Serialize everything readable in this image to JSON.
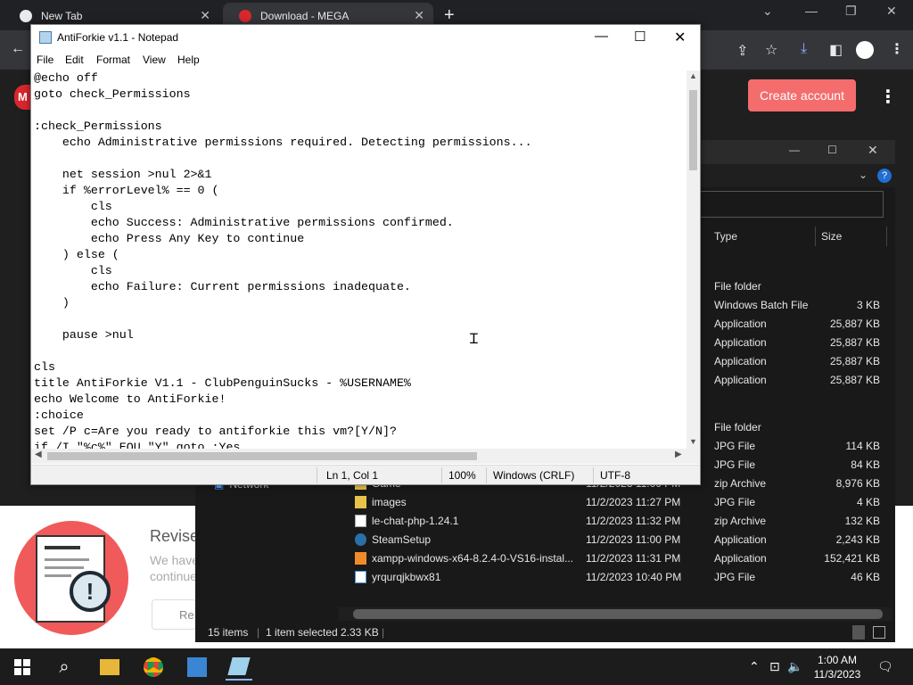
{
  "chrome": {
    "tabs": [
      {
        "title": "New Tab"
      },
      {
        "title": "Download - MEGA"
      }
    ],
    "new_tab": "+",
    "controls": {
      "minimize": "—",
      "restore": "❐",
      "close": "✕"
    }
  },
  "mega": {
    "create_account": "Create account",
    "logo": "M",
    "revise_title": "Revise",
    "revise_text": "We have continue",
    "revise_button": "Re"
  },
  "explorer": {
    "header": {
      "type": "Type",
      "size": "Size"
    },
    "left_nav": "Network",
    "rows": [
      {
        "name": "",
        "date": "",
        "type": "File folder",
        "size": ""
      },
      {
        "name": "",
        "date": "",
        "type": "Windows Batch File",
        "size": "3 KB",
        "selected": true
      },
      {
        "name": "",
        "date": "",
        "type": "Application",
        "size": "25,887 KB"
      },
      {
        "name": "",
        "date": "",
        "type": "Application",
        "size": "25,887 KB"
      },
      {
        "name": "",
        "date": "",
        "type": "Application",
        "size": "25,887 KB"
      },
      {
        "name": "",
        "date": "",
        "type": "Application",
        "size": "25,887 KB"
      },
      {
        "name": "",
        "date": "",
        "type": "",
        "size": ""
      },
      {
        "name": "",
        "date": "",
        "type": "File folder",
        "size": ""
      },
      {
        "name": "",
        "date": "",
        "type": "JPG File",
        "size": "114 KB"
      },
      {
        "name": "",
        "date": "",
        "type": "JPG File",
        "size": "84 KB"
      },
      {
        "name": "Game",
        "date": "11/2/2023 11:00 PM",
        "type": "zip Archive",
        "size": "8,976 KB"
      },
      {
        "name": "images",
        "date": "11/2/2023 11:27 PM",
        "type": "JPG File",
        "size": "4 KB"
      },
      {
        "name": "le-chat-php-1.24.1",
        "date": "11/2/2023 11:32 PM",
        "type": "zip Archive",
        "size": "132 KB"
      },
      {
        "name": "SteamSetup",
        "date": "11/2/2023 11:00 PM",
        "type": "Application",
        "size": "2,243 KB"
      },
      {
        "name": "xampp-windows-x64-8.2.4-0-VS16-instal...",
        "date": "11/2/2023 11:31 PM",
        "type": "Application",
        "size": "152,421 KB"
      },
      {
        "name": "yrqurqjkbwx81",
        "date": "11/2/2023 10:40 PM",
        "type": "JPG File",
        "size": "46 KB"
      }
    ],
    "status": {
      "items": "15 items",
      "selected": "1 item selected",
      "size": "2.33 KB"
    }
  },
  "notepad": {
    "title": "AntiForkie v1.1 - Notepad",
    "menu": [
      "File",
      "Edit",
      "Format",
      "View",
      "Help"
    ],
    "lines": [
      "@echo off",
      "goto check_Permissions",
      "",
      ":check_Permissions",
      "    echo Administrative permissions required. Detecting permissions...",
      "",
      "    net session >nul 2>&1",
      "    if %errorLevel% == 0 (",
      "        cls",
      "        echo Success: Administrative permissions confirmed.",
      "        echo Press Any Key to continue",
      "    ) else (",
      "        cls",
      "        echo Failure: Current permissions inadequate.",
      "    )",
      "",
      "    pause >nul",
      "",
      "cls",
      "title AntiForkie V1.1 - ClubPenguinSucks - %USERNAME%",
      "echo Welcome to AntiForkie!",
      ":choice",
      "set /P c=Are you ready to antiforkie this vm?[Y/N]?",
      "if /I \"%c%\" EQU \"Y\" goto :Yes"
    ],
    "status": {
      "position": "Ln 1, Col 1",
      "zoom": "100%",
      "line_ending": "Windows (CRLF)",
      "encoding": "UTF-8"
    }
  },
  "taskbar": {
    "time": "1:00 AM",
    "date": "11/3/2023"
  }
}
